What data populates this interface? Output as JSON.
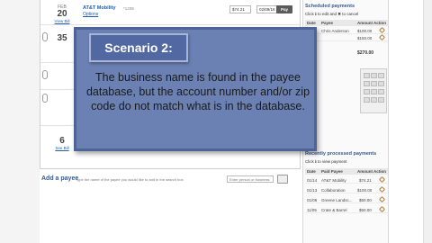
{
  "bills": [
    {
      "month": "FEB",
      "day": "20",
      "link": "View Bill",
      "payee": "AT&T Mobility",
      "payee_acct": "*1208",
      "options": "Options",
      "amount": "$74.21",
      "date": "02/09/16",
      "pay_label": "Pay"
    },
    {
      "month": "",
      "day": "35",
      "link": "",
      "payee": "",
      "payee_acct": "",
      "options": "",
      "amount": "",
      "date": "",
      "pay_label": ""
    },
    {
      "month": "",
      "day": "6",
      "link": "See Bill",
      "payee": "",
      "payee_acct": "",
      "options": "",
      "amount": "",
      "date": "",
      "pay_label": ""
    }
  ],
  "add_payee": {
    "title": "Add a payee",
    "hint": "Type the name of the payee you would like to add in the search box",
    "placeholder": "Enter person or business"
  },
  "scheduled": {
    "title": "Scheduled payments",
    "link": "Click ℹ to edit and ✖ to cancel",
    "cols": [
      "Date",
      "Payee",
      "Amount",
      "Action"
    ],
    "rows": [
      {
        "date": "03/06",
        "payee": "Chris Anderson",
        "amount": "$100.00"
      },
      {
        "date": "",
        "payee": "",
        "amount": "$150.00"
      }
    ],
    "total": "$270.00"
  },
  "recent": {
    "title": "Recently processed payments",
    "link": "Click ℹ to view payment",
    "cols": [
      "Date",
      "Paid Payee",
      "Amount",
      "Action"
    ],
    "rows": [
      {
        "date": "01/14",
        "payee": "AT&T Mobility",
        "amount": "$74.21"
      },
      {
        "date": "01/13",
        "payee": "Collaboration",
        "amount": "$100.00"
      },
      {
        "date": "01/06",
        "payee": "Greene Landsc...",
        "amount": "$50.00"
      },
      {
        "date": "11/05",
        "payee": "Crate & Barrel",
        "amount": "$50.00"
      }
    ]
  },
  "overlay": {
    "title": "Scenario 2:",
    "message": "The business name is found in the payee database, but the account number and/or zip code do not match what is in the database."
  }
}
